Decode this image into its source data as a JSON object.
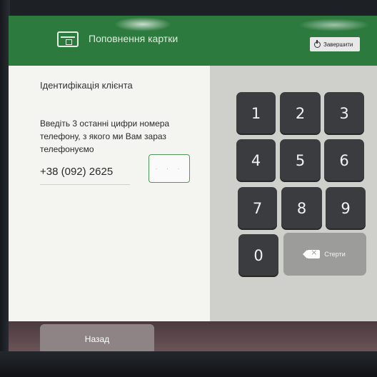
{
  "header": {
    "title": "Поповнення картки",
    "card_icon": "card-icon",
    "finish_label": "Завершити",
    "finish_icon": "power-icon",
    "bar_color": "#2d7a3e"
  },
  "form": {
    "section_title": "Ідентифікація клієнта",
    "instruction": "Введіть 3 останні цифри номера телефону, з якого ми Вам зараз телефонуємо",
    "phone": "+38 (092) 2625",
    "code_placeholder": "· · ·",
    "accent_color": "#4f9a58"
  },
  "keypad": {
    "keys": [
      "1",
      "2",
      "3",
      "4",
      "5",
      "6",
      "7",
      "8",
      "9",
      "0"
    ],
    "erase_label": "Стерти",
    "erase_icon": "backspace-icon"
  },
  "footer": {
    "back_label": "Назад"
  }
}
